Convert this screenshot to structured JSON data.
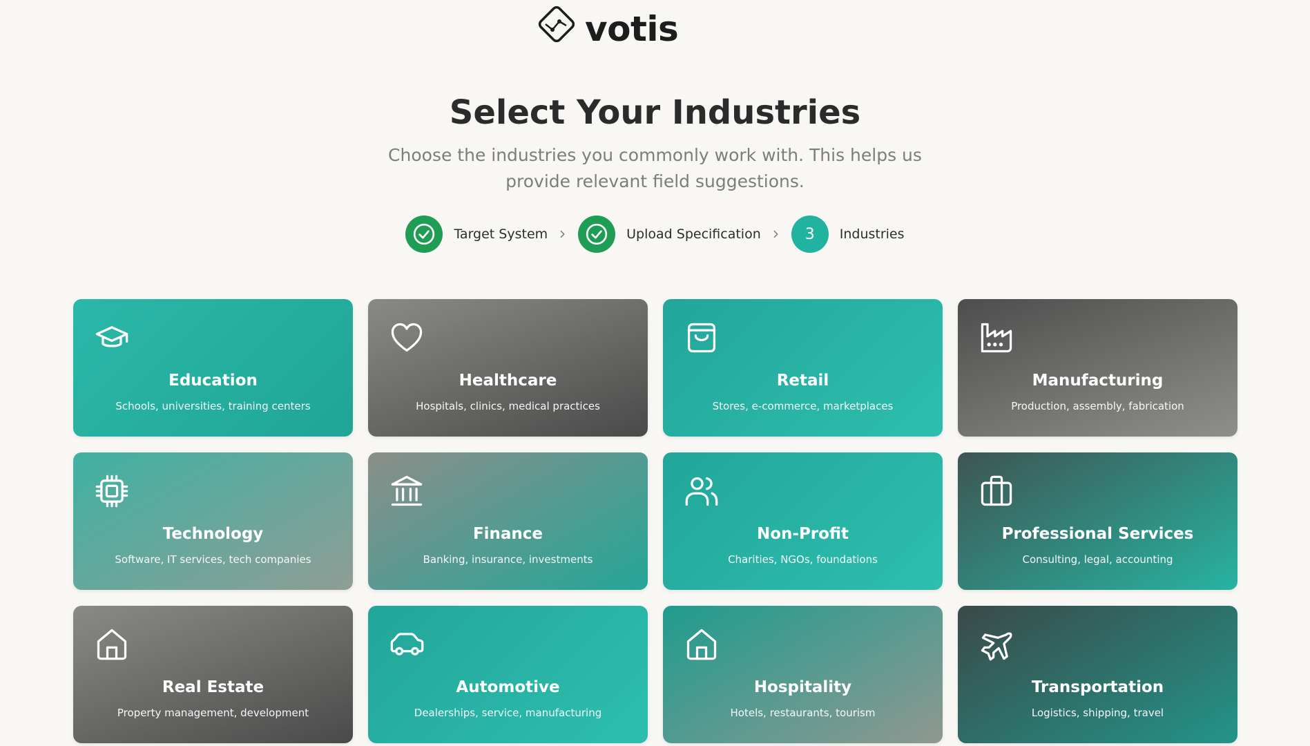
{
  "brand": {
    "name": "votis"
  },
  "header": {
    "title": "Select Your Industries",
    "subtitle": "Choose the industries you commonly work with. This helps us provide relevant field suggestions."
  },
  "stepper": {
    "steps": [
      {
        "label": "Target System",
        "status": "done"
      },
      {
        "label": "Upload Specification",
        "status": "done"
      },
      {
        "number": "3",
        "label": "Industries",
        "status": "current"
      }
    ],
    "colors": {
      "done": "#1f9d55",
      "current": "#21b3a0"
    }
  },
  "industries": [
    {
      "name": "Education",
      "description": "Schools, universities, training centers",
      "icon": "graduation-cap-icon"
    },
    {
      "name": "Healthcare",
      "description": "Hospitals, clinics, medical practices",
      "icon": "heart-icon"
    },
    {
      "name": "Retail",
      "description": "Stores, e-commerce, marketplaces",
      "icon": "shopping-bag-icon"
    },
    {
      "name": "Manufacturing",
      "description": "Production, assembly, fabrication",
      "icon": "factory-icon"
    },
    {
      "name": "Technology",
      "description": "Software, IT services, tech companies",
      "icon": "cpu-chip-icon"
    },
    {
      "name": "Finance",
      "description": "Banking, insurance, investments",
      "icon": "bank-icon"
    },
    {
      "name": "Non-Profit",
      "description": "Charities, NGOs, foundations",
      "icon": "users-icon"
    },
    {
      "name": "Professional Services",
      "description": "Consulting, legal, accounting",
      "icon": "briefcase-icon"
    },
    {
      "name": "Real Estate",
      "description": "Property management, development",
      "icon": "home-icon"
    },
    {
      "name": "Automotive",
      "description": "Dealerships, service, manufacturing",
      "icon": "car-icon"
    },
    {
      "name": "Hospitality",
      "description": "Hotels, restaurants, tourism",
      "icon": "home-icon"
    },
    {
      "name": "Transportation",
      "description": "Logistics, shipping, travel",
      "icon": "plane-icon"
    }
  ]
}
